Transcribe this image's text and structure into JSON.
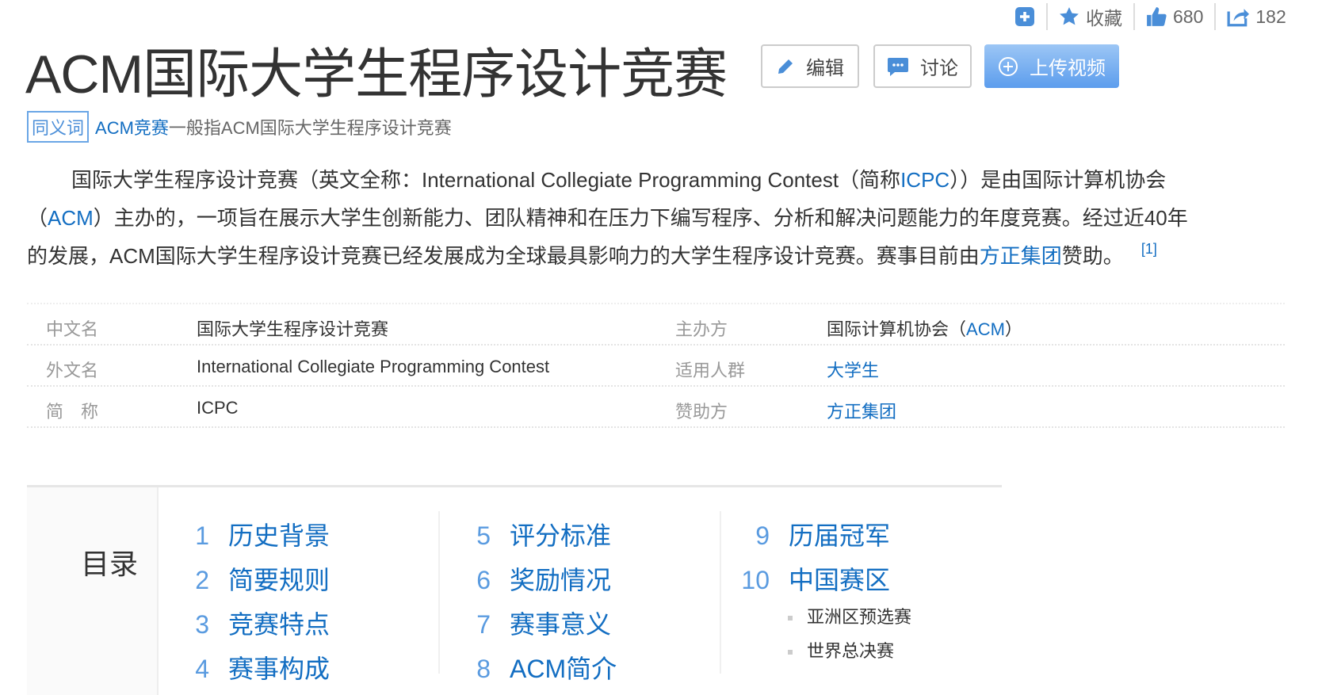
{
  "topbar": {
    "icons": [
      "plus-icon",
      "star-icon",
      "thumbs-up-icon",
      "share-icon"
    ],
    "favorite_label": "收藏",
    "likes": "680",
    "shares": "182"
  },
  "title": "ACM国际大学生程序设计竞赛",
  "buttons": {
    "edit": "编辑",
    "discuss": "讨论",
    "upload_video": "上传视频"
  },
  "synonym": {
    "badge": "同义词",
    "term": "ACM竞赛",
    "text": "一般指ACM国际大学生程序设计竞赛"
  },
  "paragraph": {
    "l1a": "国际大学生程序设计竞赛（英文全称：International Collegiate Programming Contest（简称",
    "l1link": "ICPC",
    "l1b": "））是由国际计算机协会",
    "l2a": "（",
    "l2link": "ACM",
    "l2b": "）主办的，一项旨在展示大学生创新能力、团队精神和在压力下编写程序、分析和解决问题能力的年度竞赛。经过近40年",
    "l3a": "的发展，ACM国际大学生程序设计竞赛已经发展成为全球最具影响力的大学生程序设计竞赛。赛事目前由",
    "l3link": "方正集团",
    "l3b": "赞助。",
    "ref": "[1]"
  },
  "info": [
    {
      "label": "中文名",
      "value": "国际大学生程序设计竞赛",
      "label2": "主办方",
      "value2": "国际计算机协会（",
      "value2link": "ACM",
      "value2end": "）"
    },
    {
      "label": "外文名",
      "value": "International Collegiate Programming Contest",
      "label2": "适用人群",
      "value2link": "大学生"
    },
    {
      "label": "简　称",
      "value": "ICPC",
      "label2": "赞助方",
      "value2link": "方正集团"
    }
  ],
  "toc": {
    "title": "目录",
    "items": [
      {
        "num": "1",
        "label": "历史背景"
      },
      {
        "num": "2",
        "label": "简要规则"
      },
      {
        "num": "3",
        "label": "竞赛特点"
      },
      {
        "num": "4",
        "label": "赛事构成"
      },
      {
        "num": "5",
        "label": "评分标准"
      },
      {
        "num": "6",
        "label": "奖励情况"
      },
      {
        "num": "7",
        "label": "赛事意义"
      },
      {
        "num": "8",
        "label": "ACM简介"
      },
      {
        "num": "9",
        "label": "历届冠军"
      },
      {
        "num": "10",
        "label": "中国赛区"
      }
    ],
    "subitems": [
      "亚洲区预选赛",
      "世界总决赛"
    ]
  },
  "colors": {
    "link": "#136ec2",
    "accent": "#5c9ded"
  }
}
